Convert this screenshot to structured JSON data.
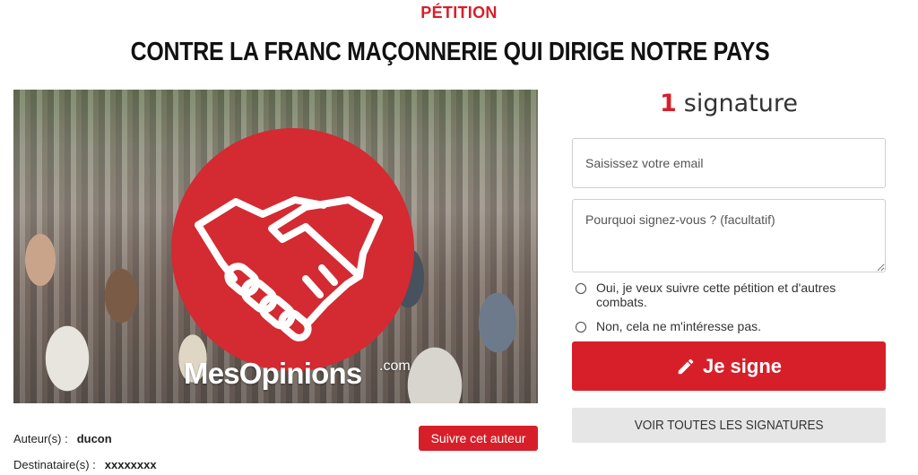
{
  "header": {
    "eyebrow": "PÉTITION",
    "title": "CONTRE LA FRANC MAÇONNERIE QUI DIRIGE NOTRE PAYS"
  },
  "hero": {
    "watermark": "MesOpinions",
    "watermark_suffix": ".com",
    "logo_icon": "handshake-icon",
    "logo_color": "#d42a32"
  },
  "meta": {
    "author_label": "Auteur(s) :",
    "author_value": "ducon",
    "recipient_label": "Destinataire(s) :",
    "recipient_value": "xxxxxxxx",
    "follow_label": "Suivre cet auteur"
  },
  "signatures": {
    "count": "1",
    "label": "signature"
  },
  "form": {
    "email_placeholder": "Saisissez votre email",
    "email_value": "",
    "reason_placeholder": "Pourquoi signez-vous ? (facultatif)",
    "reason_value": "",
    "option_yes": "Oui, je veux suivre cette pétition et d'autres combats.",
    "option_no": "Non, cela ne m'intéresse pas.",
    "sign_label": "Je signe",
    "sign_icon": "pencil-icon",
    "all_signatures_label": "VOIR TOUTES LES SIGNATURES"
  },
  "colors": {
    "accent": "#d71f2a",
    "secondary_button": "#e6e6e6"
  }
}
